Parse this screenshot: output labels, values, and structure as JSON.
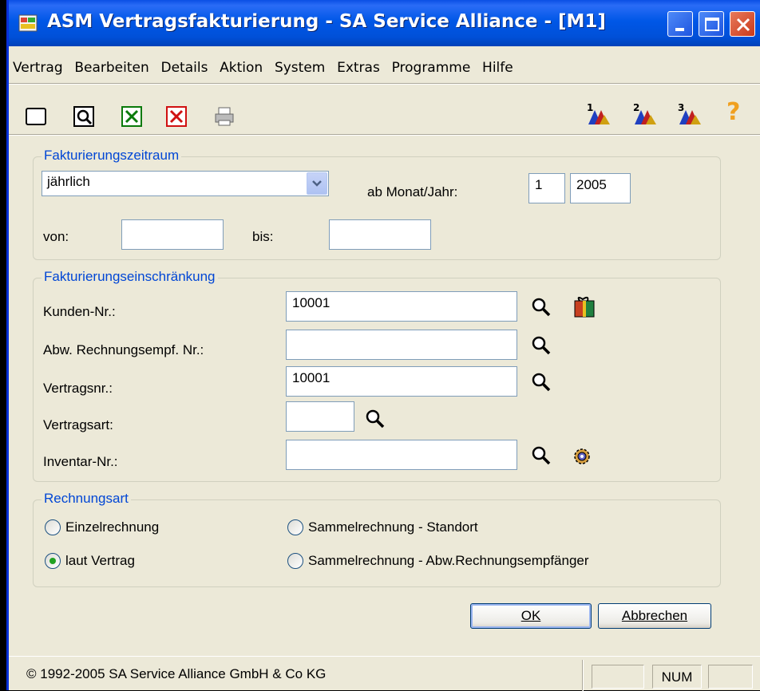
{
  "window": {
    "title": "ASM Vertragsfakturierung - SA Service Alliance  - [M1]"
  },
  "menu": [
    "Vertrag",
    "Bearbeiten",
    "Details",
    "Aktion",
    "System",
    "Extras",
    "Programme",
    "Hilfe"
  ],
  "toolbar": {
    "left_icons": [
      "new-icon",
      "preview-icon",
      "excel-icon",
      "delete-icon",
      "print-icon"
    ],
    "right_icons": [
      "step1-icon",
      "step2-icon",
      "step3-icon",
      "help-icon"
    ],
    "step_labels": [
      "1",
      "2",
      "3"
    ],
    "help_label": "?"
  },
  "period": {
    "legend": "Fakturierungszeitraum",
    "interval_value": "jährlich",
    "ab_label": "ab Monat/Jahr:",
    "month_value": "1",
    "year_value": "2005",
    "von_label": "von:",
    "von_value": "",
    "bis_label": "bis:",
    "bis_value": ""
  },
  "restriction": {
    "legend": "Fakturierungseinschränkung",
    "kunden_label": "Kunden-Nr.:",
    "kunden_value": "10001",
    "abw_label": "Abw. Rechnungsempf. Nr.:",
    "abw_value": "",
    "vertragsnr_label": "Vertragsnr.:",
    "vertragsnr_value": "10001",
    "vertragsart_label": "Vertragsart:",
    "vertragsart_value": "",
    "inventar_label": "Inventar-Nr.:",
    "inventar_value": ""
  },
  "invoice_type": {
    "legend": "Rechnungsart",
    "options": [
      {
        "label": "Einzelrechnung",
        "checked": false
      },
      {
        "label": "Sammelrechnung - Standort",
        "checked": false
      },
      {
        "label": "laut Vertrag",
        "checked": true
      },
      {
        "label": "Sammelrechnung - Abw.Rechnungsempfänger",
        "checked": false
      }
    ]
  },
  "buttons": {
    "ok_label": "OK",
    "cancel_label": "Abbrechen"
  },
  "status": {
    "copyright": "© 1992-2005  SA Service Alliance GmbH & Co KG",
    "num": "NUM"
  },
  "colors": {
    "legend": "#0046d5",
    "titlebar": "#0054e3",
    "window_bg": "#ece9d8"
  }
}
